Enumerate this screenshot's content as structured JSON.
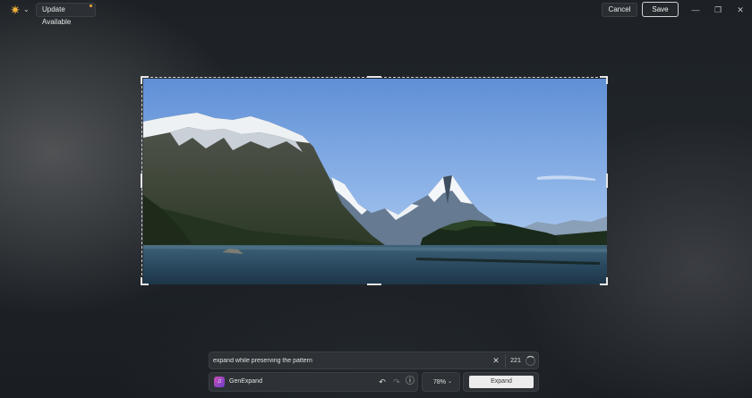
{
  "titlebar": {
    "update_label": "Update Available",
    "cancel_label": "Cancel",
    "save_label": "Save",
    "minimize_glyph": "—",
    "restore_glyph": "❐",
    "close_glyph": "✕",
    "app_icon": "sun-icon"
  },
  "prompt": {
    "value": "expand while preserving the pattern",
    "count": "221"
  },
  "toolbar": {
    "genexpand_label": "GenExpand",
    "zoom_label": "78%",
    "expand_label": "Expand",
    "undo_glyph": "↶",
    "redo_glyph": "↷",
    "info_glyph": "ⓘ"
  },
  "colors": {
    "accent_update_dot": "#f4a23a",
    "app_icon": "#f3b43a",
    "genexpand_gradient": [
      "#c94fb5",
      "#6f3ec9"
    ]
  }
}
